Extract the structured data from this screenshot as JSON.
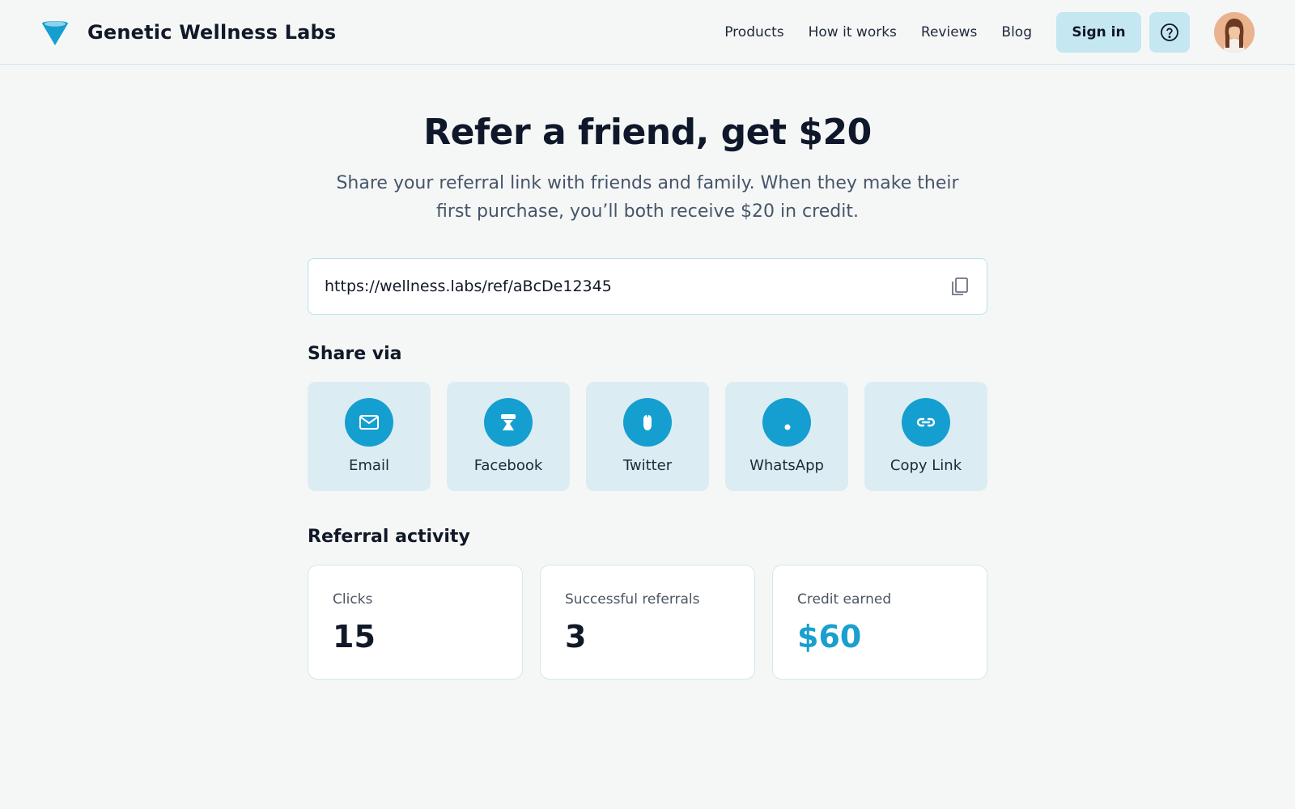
{
  "brand": {
    "name": "Genetic Wellness Labs",
    "logo_icon": "cone-logo-icon"
  },
  "nav": {
    "links": [
      "Products",
      "How it works",
      "Reviews",
      "Blog"
    ],
    "sign_in_label": "Sign in",
    "help_icon": "question-circle-icon",
    "avatar_icon": "user-avatar"
  },
  "hero": {
    "title": "Refer a friend, get $20",
    "subtitle": "Share your referral link with friends and family. When they make their first purchase, you’ll both receive $20 in credit."
  },
  "referral_link": {
    "value": "https://wellness.labs/ref/aBcDe12345",
    "copy_icon": "copy-icon"
  },
  "share": {
    "title": "Share via",
    "options": [
      {
        "label": "Email",
        "icon": "envelope-icon"
      },
      {
        "label": "Facebook",
        "icon": "facebook-icon"
      },
      {
        "label": "Twitter",
        "icon": "twitter-icon"
      },
      {
        "label": "WhatsApp",
        "icon": "whatsapp-icon"
      },
      {
        "label": "Copy Link",
        "icon": "link-icon"
      }
    ]
  },
  "activity": {
    "title": "Referral activity",
    "stats": [
      {
        "label": "Clicks",
        "value": "15"
      },
      {
        "label": "Successful referrals",
        "value": "3"
      },
      {
        "label": "Credit earned",
        "value": "$60"
      }
    ]
  },
  "colors": {
    "accent": "#159fd0",
    "accent_text": "#1a9fcf",
    "button_bg": "#c5e7f1",
    "card_bg": "#dbedf3",
    "page_bg": "#f5f7f7"
  }
}
